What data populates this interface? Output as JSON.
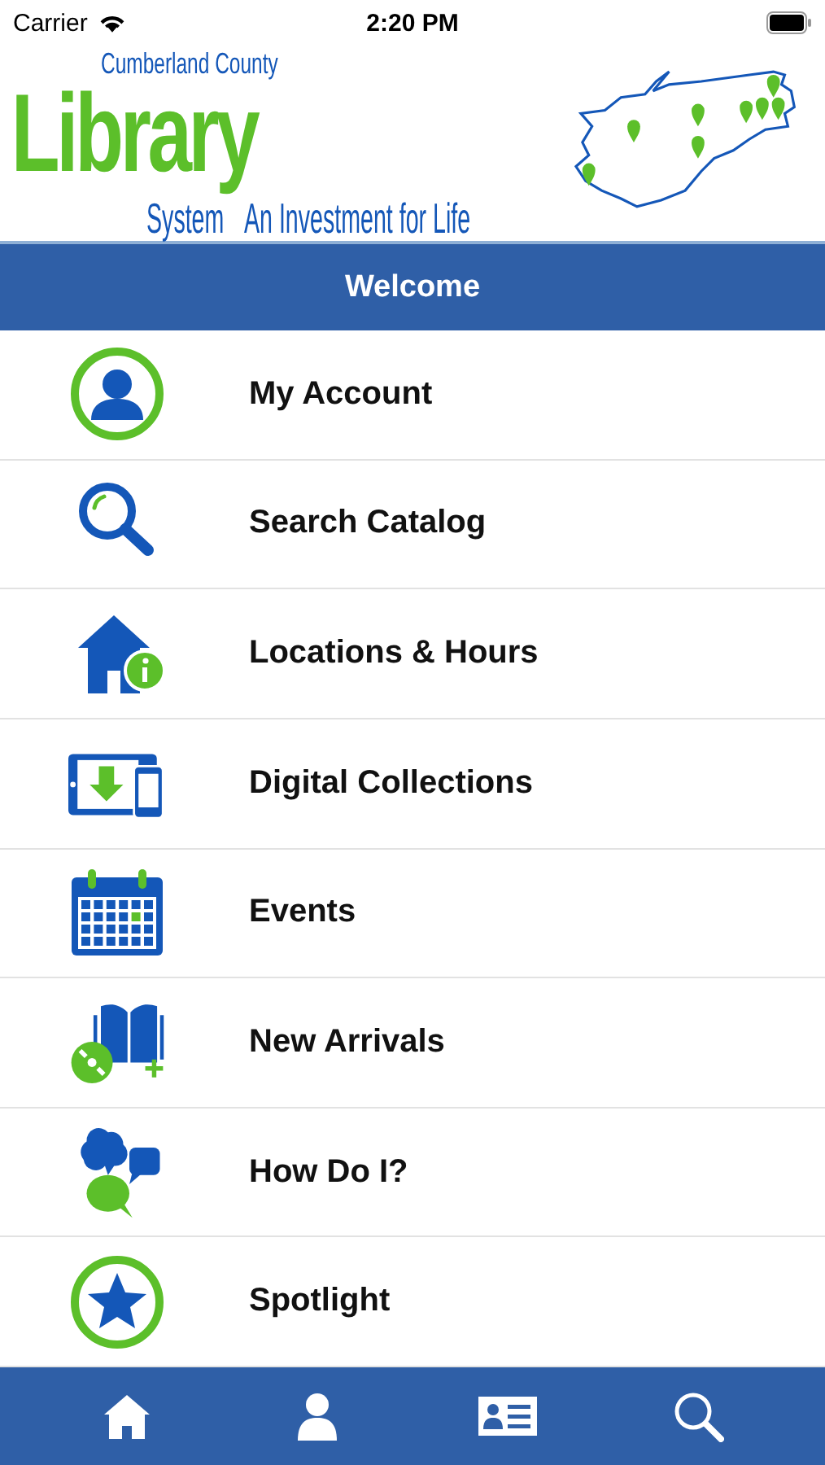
{
  "status_bar": {
    "carrier": "Carrier",
    "time": "2:20 PM"
  },
  "logo": {
    "county": "Cumberland County",
    "name": "Library",
    "system": "System",
    "tagline": "An Investment for Life"
  },
  "header": {
    "title": "Welcome"
  },
  "menu": [
    {
      "kind": "account",
      "label": "My Account"
    },
    {
      "kind": "search",
      "label": "Search Catalog"
    },
    {
      "kind": "locations",
      "label": "Locations & Hours"
    },
    {
      "kind": "digital",
      "label": "Digital Collections"
    },
    {
      "kind": "events",
      "label": "Events"
    },
    {
      "kind": "arrivals",
      "label": "New Arrivals"
    },
    {
      "kind": "help",
      "label": "How Do I?"
    },
    {
      "kind": "spotlight",
      "label": "Spotlight"
    }
  ],
  "tab_bar": [
    {
      "kind": "home"
    },
    {
      "kind": "account"
    },
    {
      "kind": "card"
    },
    {
      "kind": "search"
    }
  ]
}
